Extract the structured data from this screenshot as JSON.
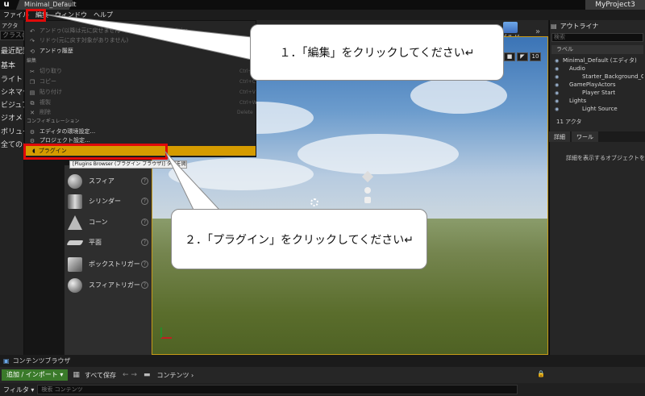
{
  "window": {
    "logo": "u",
    "doc_tab": "Minimal_Default",
    "project": "MyProject3"
  },
  "menubar": [
    "ファイル",
    "編集",
    "ウィンドウ",
    "ヘルプ"
  ],
  "left_panel": {
    "tab_label": "アクタ",
    "search_placeholder": "クラスの検",
    "categories": [
      "最近配置",
      "基本",
      "ライト",
      "シネマティ",
      "ビジュア",
      "ジオメト",
      "ボリュー",
      "全てのク"
    ]
  },
  "place_items": [
    "スフィア",
    "シリンダー",
    "コーン",
    "平面",
    "ボックストリガー",
    "スフィアトリガー"
  ],
  "edit_menu": {
    "undo": "アンドゥ(以降は元に戻せません マップをロード中: Minim",
    "redo": "リドゥ(元に戻す対象がありません)",
    "history": "アンドゥ履歴",
    "section_edit": "編集",
    "cut": "切り取り",
    "copy": "コピー",
    "paste": "貼り付け",
    "duplicate": "複製",
    "delete": "削除",
    "shortcut_cut": "Ctrl+X",
    "shortcut_copy": "Ctrl+C",
    "shortcut_paste": "Ctrl+V",
    "shortcut_dup": "Ctrl+W",
    "shortcut_del": "Delete",
    "section_config": "コンフィギュレーション",
    "editor_prefs": "エディタの環境設定...",
    "project_settings": "プロジェクト設定...",
    "plugins": "プラグイン",
    "tooltip": "[Plugins Browser (プラグイン ブラウザ)] タブを開きます。"
  },
  "toolbar": {
    "build": "ビルド",
    "expand": "»"
  },
  "viewport_toolbar": [
    "■",
    "◤",
    "10"
  ],
  "outliner": {
    "title": "アウトライナ",
    "search_placeholder": "検索",
    "label_header": "ラベル",
    "rows": [
      "Minimal_Default (エディタ)",
      "Audio",
      "Starter_Background_Cue",
      "GamePlayActors",
      "Player Start",
      "Lights",
      "Light Source"
    ],
    "actor_count": "11 アクタ"
  },
  "details": {
    "tab1": "詳細",
    "tab2": "ワール",
    "empty_text": "詳細を表示するオブジェクトを"
  },
  "content_browser": {
    "tab": "コンテンツブラウザ",
    "add_import": "追加 / インポート ▾",
    "save_all": "すべて保存",
    "nav": "← →",
    "path": "コンテンツ ›",
    "filter": "フィルタ ▾",
    "search_placeholder": "検索 コンテンツ"
  },
  "callouts": {
    "step1": "１．「編集」をクリックしてください↵",
    "step2": "２．「プラグイン」をクリックしてください↵"
  },
  "colors": {
    "highlight": "#e00a0a",
    "accent": "#d59b00",
    "viewport_border": "#c79a18"
  }
}
